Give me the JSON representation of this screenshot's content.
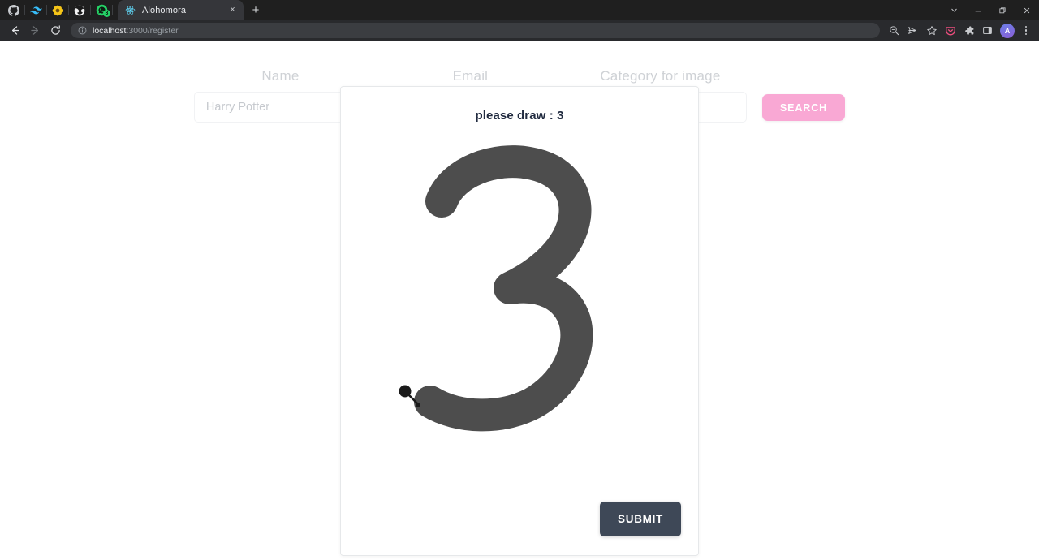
{
  "browser": {
    "pinned_tabs": [
      {
        "name": "github-pinned-tab",
        "icon": "github-icon",
        "badge": ""
      },
      {
        "name": "tailwind-pinned-tab",
        "icon": "wave-icon",
        "badge": ""
      },
      {
        "name": "flower-pinned-tab",
        "icon": "flower-icon",
        "badge": ""
      },
      {
        "name": "globe-pinned-tab",
        "icon": "globe-icon",
        "badge": ""
      },
      {
        "name": "whatsapp-pinned-tab",
        "icon": "whatsapp-icon",
        "badge": "3"
      }
    ],
    "active_tab": {
      "title": "Alohomora",
      "favicon": "react-atom-icon",
      "close_label": "×"
    },
    "new_tab_label": "+",
    "window_controls": {
      "tab_search": "tab-search-chevron-icon",
      "minimize": "minimize-icon",
      "maximize": "maximize-icon",
      "close": "close-icon"
    },
    "toolbar": {
      "back": "back-arrow-icon",
      "forward": "forward-arrow-icon",
      "reload": "reload-icon",
      "site_info": "site-info-icon",
      "url_host": "localhost",
      "url_path": ":3000/register",
      "actions": [
        {
          "name": "zoom-icon"
        },
        {
          "name": "send-share-icon"
        },
        {
          "name": "bookmark-star-icon"
        },
        {
          "name": "pocket-icon"
        },
        {
          "name": "extensions-puzzle-icon"
        },
        {
          "name": "side-panel-icon"
        }
      ],
      "avatar_initial": "A",
      "menu": "three-dot-menu-icon"
    }
  },
  "page": {
    "form": {
      "fields": [
        {
          "label": "Name",
          "placeholder": "Harry Potter",
          "value": ""
        },
        {
          "label": "Email",
          "placeholder": "",
          "value": ""
        },
        {
          "label": "Category for image",
          "placeholder": "",
          "value": ""
        }
      ],
      "search_button": "SEARCH"
    }
  },
  "modal": {
    "title": "please draw : 3",
    "prompt_digit": "3",
    "submit_button": "SUBMIT",
    "drawing": {
      "name": "handwritten-digit-3",
      "stroke_color": "#4d4d4d",
      "stroke_width": 40,
      "cursor_dot_color": "#1a1a1a"
    }
  },
  "colors": {
    "accent_pink": "#f9a8d4",
    "submit_slate": "#3e4857",
    "label_gray": "#cfd2d6",
    "modal_title": "#212b40",
    "page_background": "#ffffff",
    "chrome_tabstrip": "#1f1f1f",
    "chrome_toolbar": "#292a2d"
  }
}
